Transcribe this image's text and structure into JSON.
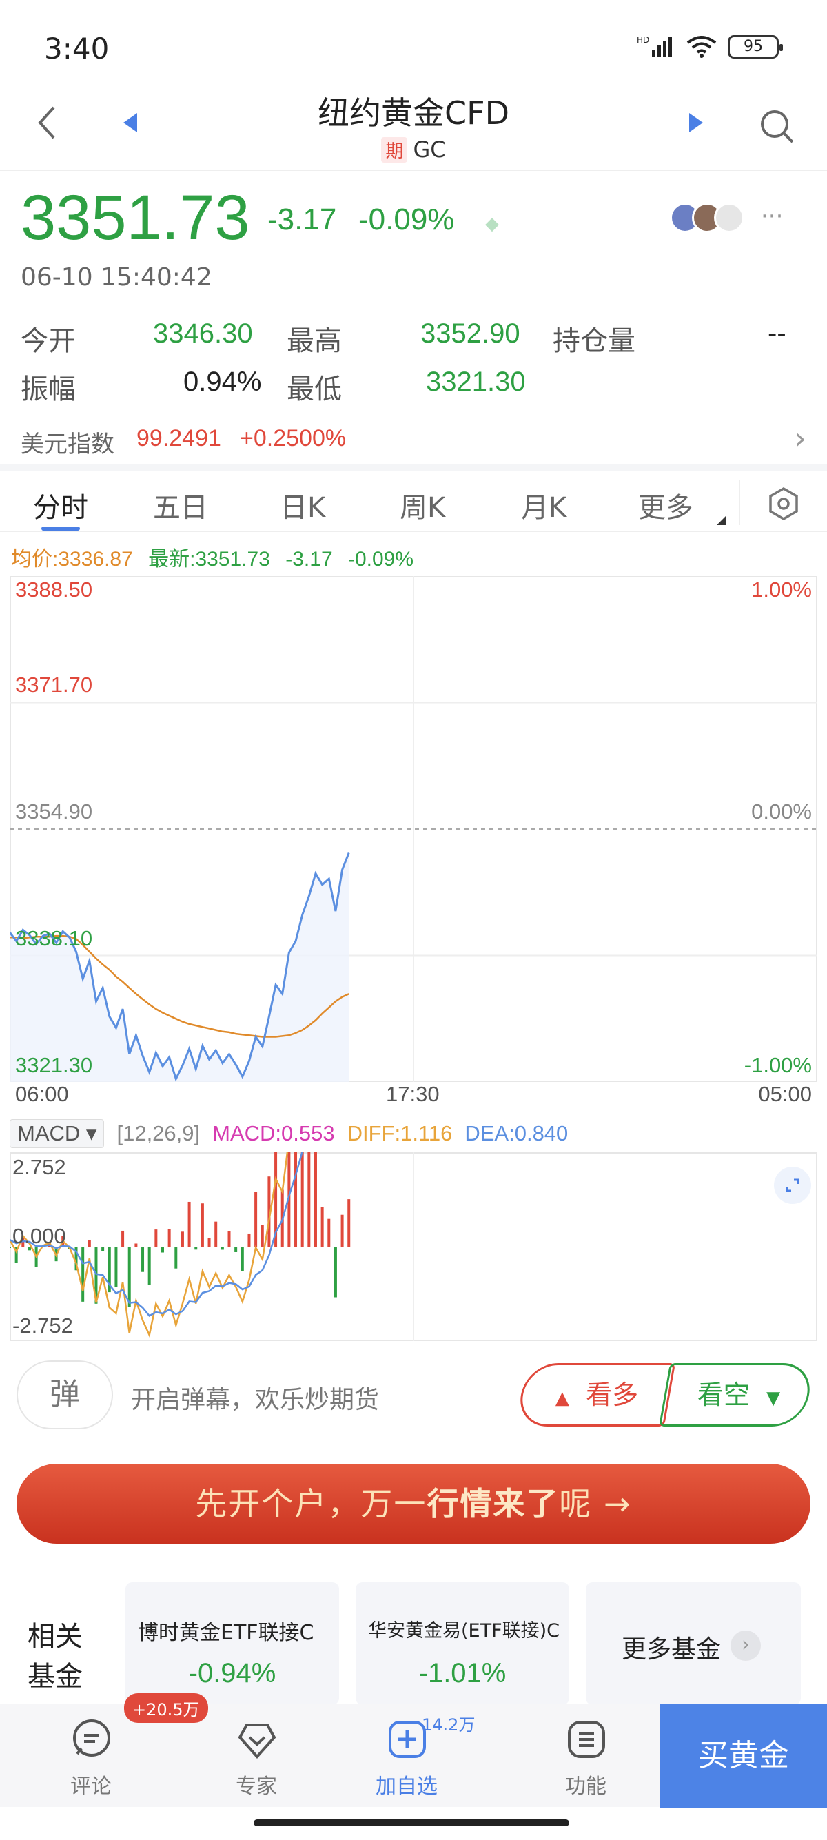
{
  "status": {
    "time": "3:40",
    "battery": "95",
    "network": "HD"
  },
  "nav": {
    "title": "纽约黄金CFD",
    "tag": "期",
    "code": "GC"
  },
  "quote": {
    "price": "3351.73",
    "change": "-3.17",
    "change_pct": "-0.09%",
    "datetime": "06-10 15:40:42"
  },
  "stats": {
    "open_label": "今开",
    "open_value": "3346.30",
    "high_label": "最高",
    "high_value": "3352.90",
    "oi_label": "持仓量",
    "oi_value": "--",
    "amp_label": "振幅",
    "amp_value": "0.94%",
    "low_label": "最低",
    "low_value": "3321.30"
  },
  "usd_index": {
    "label": "美元指数",
    "value": "99.2491",
    "change": "+0.2500%"
  },
  "tabs": [
    "分时",
    "五日",
    "日K",
    "周K",
    "月K",
    "更多"
  ],
  "legend": {
    "avg": "均价:3336.87",
    "latest": "最新:3351.73",
    "change": "-3.17",
    "change_pct": "-0.09%"
  },
  "chart_labels": {
    "y_top": "3388.50",
    "y_2": "3371.70",
    "y_mid": "3354.90",
    "y_4": "3338.10",
    "y_bottom": "3321.30",
    "pct_top": "1.00%",
    "pct_mid": "0.00%",
    "pct_bottom": "-1.00%",
    "x_start": "06:00",
    "x_mid": "17:30",
    "x_end": "05:00"
  },
  "macd": {
    "select": "MACD",
    "params": "[12,26,9]",
    "macd": "MACD:0.553",
    "diff": "DIFF:1.116",
    "dea": "DEA:0.840",
    "y_top": "2.752",
    "y_mid": "0.000",
    "y_bottom": "-2.752"
  },
  "danmu": {
    "icon_text": "弹",
    "placeholder": "开启弹幕，欢乐炒期货",
    "bull": "看多",
    "bear": "看空"
  },
  "cta": {
    "text_a": "先开个户，万一",
    "text_b": "行情来了",
    "text_c": "呢 →"
  },
  "funds": {
    "title": "相关基金",
    "items": [
      {
        "name": "博时黄金ETF联接C",
        "pct": "-0.94%"
      },
      {
        "name": "华安黄金易(ETF联接)C",
        "pct": "-1.01%"
      }
    ],
    "more": "更多基金"
  },
  "bottom": {
    "comment": "评论",
    "comment_badge": "+20.5万",
    "expert": "专家",
    "watch": "加自选",
    "watch_count": "14.2万",
    "func": "功能",
    "buy": "买黄金"
  },
  "colors": {
    "up": "#e0483b",
    "down": "#2ea043",
    "accent": "#4a7fe5",
    "avg_line": "#e08a2a",
    "price_line": "#5b8fe0"
  },
  "chart_data": {
    "type": "line",
    "title": "",
    "x_ticks": [
      "06:00",
      "17:30",
      "05:00"
    ],
    "ylim": [
      3321.3,
      3388.5
    ],
    "reference": 3354.9,
    "series": [
      {
        "name": "最新",
        "values": [
          3341.2,
          3340.0,
          3341.5,
          3340.8,
          3339.6,
          3340.7,
          3341.0,
          3339.8,
          3341.3,
          3340.5,
          3338.6,
          3335.0,
          3337.4,
          3332.0,
          3333.8,
          3330.0,
          3328.5,
          3331.0,
          3325.0,
          3327.5,
          3324.8,
          3322.6,
          3325.2,
          3323.4,
          3324.6,
          3321.7,
          3323.5,
          3325.7,
          3323.0,
          3326.1,
          3324.3,
          3325.5,
          3323.8,
          3325.0,
          3323.6,
          3322.0,
          3324.1,
          3327.3,
          3326.0,
          3330.0,
          3334.2,
          3333.0,
          3338.5,
          3340.0,
          3343.5,
          3346.0,
          3349.0,
          3347.5,
          3348.3,
          3344.0,
          3349.5,
          3351.73
        ]
      },
      {
        "name": "均价",
        "values": [
          3340.5,
          3340.5,
          3340.4,
          3340.5,
          3340.6,
          3340.6,
          3340.6,
          3340.7,
          3340.7,
          3340.6,
          3340.3,
          3339.5,
          3338.6,
          3337.7,
          3336.9,
          3336.2,
          3335.3,
          3334.6,
          3333.8,
          3333.0,
          3332.3,
          3331.6,
          3331.0,
          3330.5,
          3330.1,
          3329.7,
          3329.3,
          3329.0,
          3328.8,
          3328.6,
          3328.4,
          3328.2,
          3328.0,
          3327.9,
          3327.7,
          3327.6,
          3327.5,
          3327.4,
          3327.3,
          3327.3,
          3327.3,
          3327.4,
          3327.5,
          3327.8,
          3328.2,
          3328.8,
          3329.5,
          3330.4,
          3331.2,
          3332.0,
          3332.6,
          3333.0
        ]
      }
    ]
  }
}
